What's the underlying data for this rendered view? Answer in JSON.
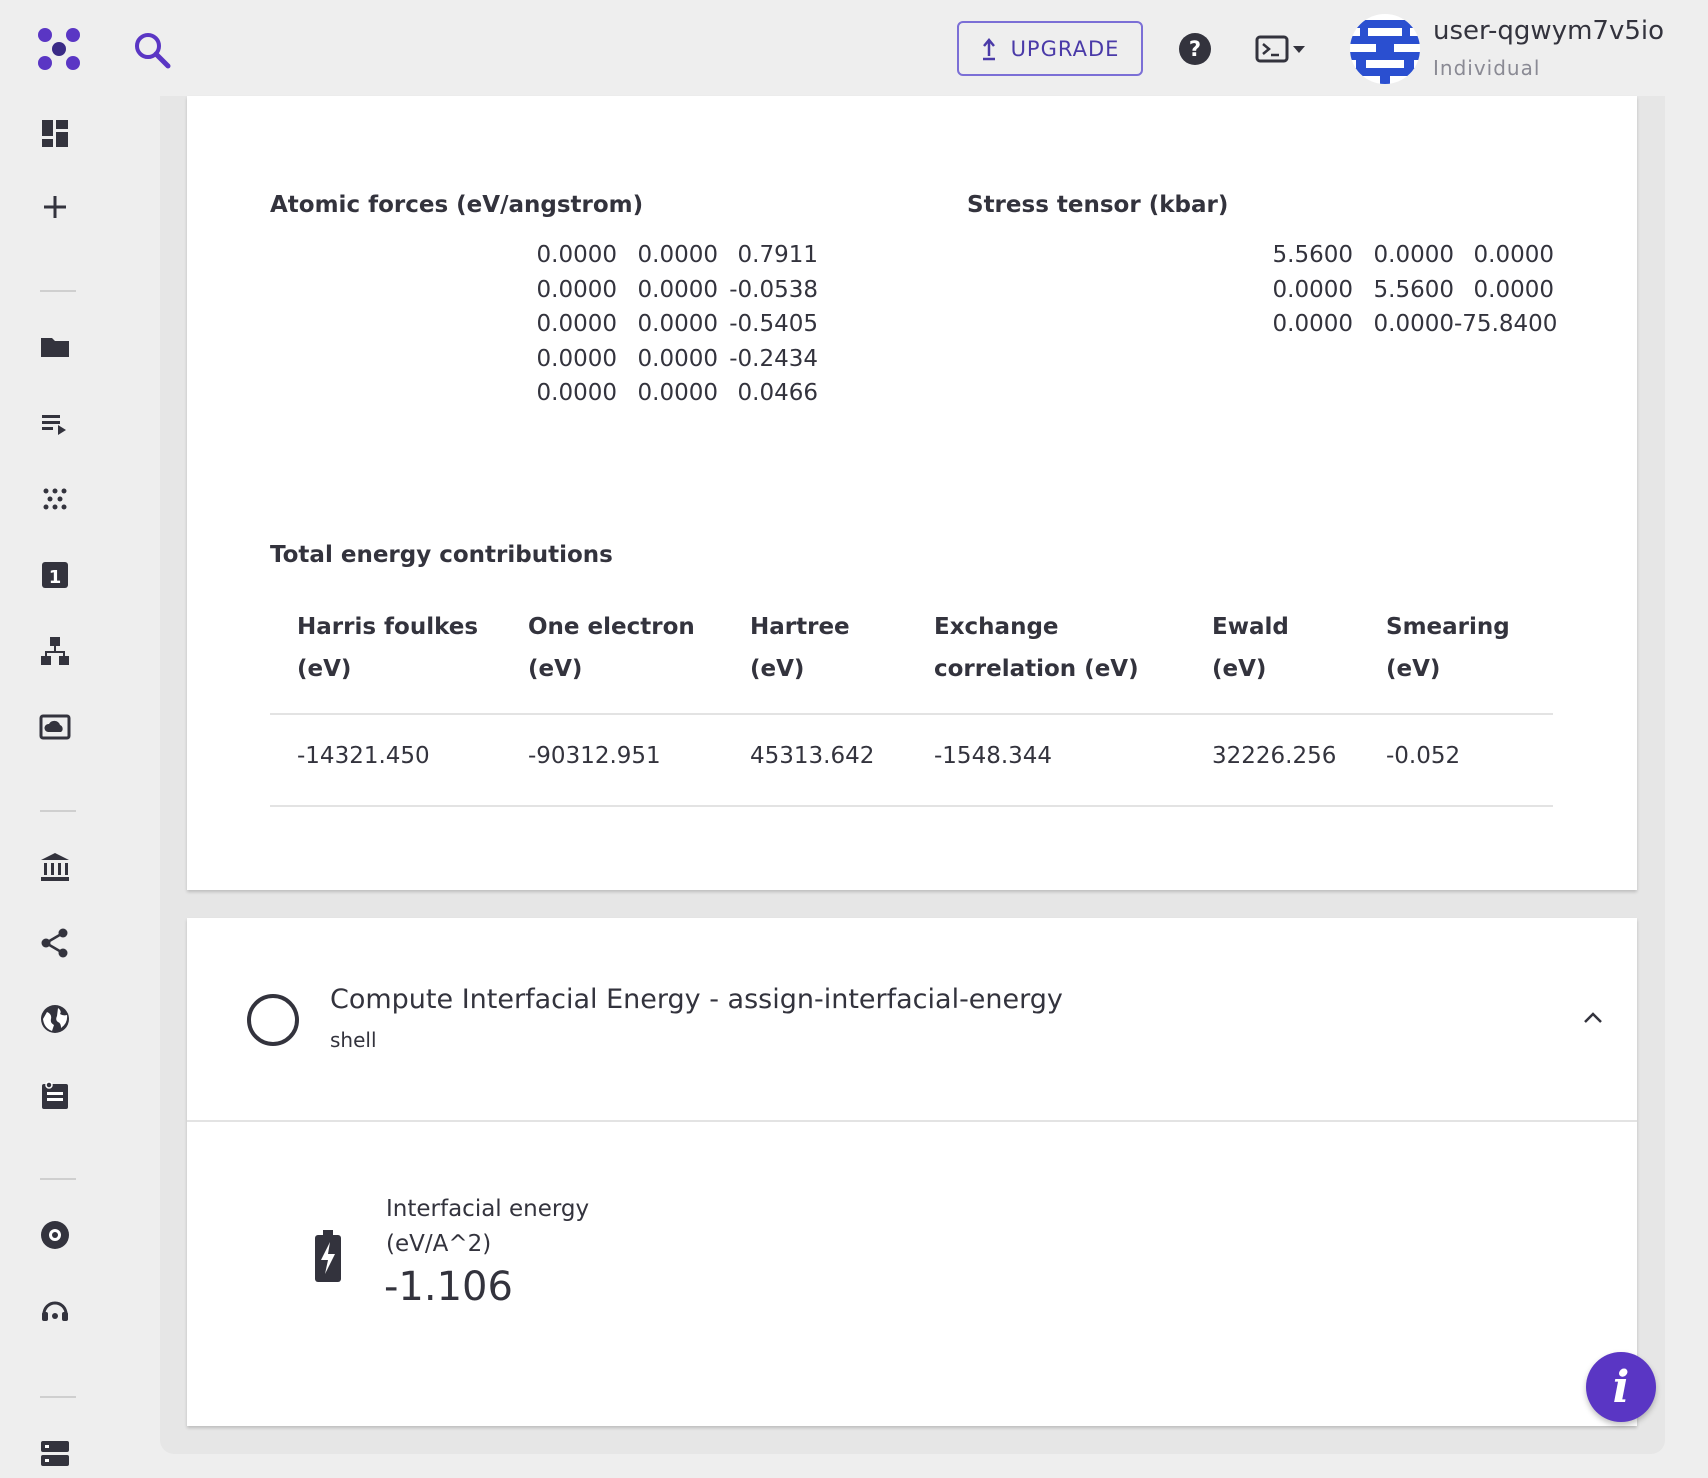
{
  "header": {
    "upgrade_label": "UPGRADE",
    "user_name": "user-qgwym7v5io",
    "user_plan": "Individual"
  },
  "sidebar": {
    "icons": [
      "dashboard-icon",
      "add-icon",
      "folder-icon",
      "playlist-icon",
      "materials-icon",
      "number-one-icon",
      "workflow-icon",
      "cloud-storage-icon",
      "bank-icon",
      "share-icon",
      "globe-icon",
      "notes-icon",
      "help-ring-icon",
      "support-icon",
      "server-icon"
    ]
  },
  "results": {
    "atomic_forces": {
      "title": "Atomic forces (eV/angstrom)",
      "rows": [
        [
          "0.0000",
          "0.0000",
          "0.7911"
        ],
        [
          "0.0000",
          "0.0000",
          "-0.0538"
        ],
        [
          "0.0000",
          "0.0000",
          "-0.5405"
        ],
        [
          "0.0000",
          "0.0000",
          "-0.2434"
        ],
        [
          "0.0000",
          "0.0000",
          "0.0466"
        ]
      ]
    },
    "stress_tensor": {
      "title": "Stress tensor (kbar)",
      "rows": [
        [
          "5.5600",
          "0.0000",
          "0.0000"
        ],
        [
          "0.0000",
          "5.5600",
          "0.0000"
        ],
        [
          "0.0000",
          "0.0000",
          "-75.8400"
        ]
      ]
    },
    "energy_contributions": {
      "title": "Total energy contributions",
      "columns": [
        [
          "Harris foulkes",
          "(eV)"
        ],
        [
          "One electron",
          "(eV)"
        ],
        [
          "Hartree",
          "(eV)"
        ],
        [
          "Exchange",
          "correlation (eV)"
        ],
        [
          "Ewald",
          "(eV)"
        ],
        [
          "Smearing",
          "(eV)"
        ]
      ],
      "values": [
        "-14321.450",
        "-90312.951",
        "45313.642",
        "-1548.344",
        "32226.256",
        "-0.052"
      ]
    }
  },
  "unit": {
    "title": "Compute Interfacial Energy - assign-interfacial-energy",
    "type": "shell",
    "property_label_line1": "Interfacial energy",
    "property_label_line2": "(eV/A^2)",
    "property_value": "-1.106"
  },
  "colors": {
    "accent": "#5a36c4",
    "text": "#33333d",
    "background": "#eeeeee"
  }
}
